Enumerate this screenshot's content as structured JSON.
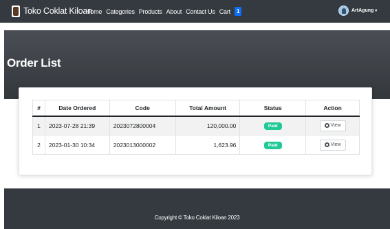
{
  "navbar": {
    "brand": "Toko Coklat Kiloan",
    "links": [
      "Home",
      "Categories",
      "Products",
      "About",
      "Contact Us",
      "Cart"
    ],
    "cart_count": "1",
    "user_name": "ArtAgung",
    "user_caret": "▾"
  },
  "page": {
    "title": "Order List"
  },
  "table": {
    "headers": [
      "#",
      "Date Ordered",
      "Code",
      "Total Amount",
      "Status",
      "Action"
    ],
    "rows": [
      {
        "num": "1",
        "date": "2023-07-28 21:39",
        "code": "2023072800004",
        "total": "120,000.00",
        "status": "Paid",
        "action": "View"
      },
      {
        "num": "2",
        "date": "2023-01-30 10:34",
        "code": "2023013000002",
        "total": "1,623.96",
        "status": "Paid",
        "action": "View"
      }
    ]
  },
  "footer": {
    "text": "Copyright © Toko Coklat Kiloan 2023"
  },
  "colors": {
    "navbar": "#343a40",
    "badge_paid": "#20c997",
    "cart_badge": "#0d6efd"
  }
}
